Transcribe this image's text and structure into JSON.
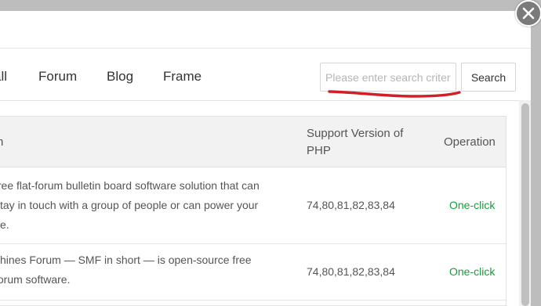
{
  "dialog": {
    "close_icon": "close-icon"
  },
  "tabs": [
    {
      "label": "all"
    },
    {
      "label": "Forum"
    },
    {
      "label": "Blog"
    },
    {
      "label": "Frame"
    }
  ],
  "search": {
    "placeholder": "Please enter search criteria",
    "button_label": "Search"
  },
  "table": {
    "headers": {
      "name": "n",
      "version": "Support Version of PHP",
      "operation": "Operation"
    },
    "rows": [
      {
        "description_lines": [
          "free flat-forum bulletin board software solution that can",
          "stay in touch with a group of people or can power your",
          "ite."
        ],
        "version": "74,80,81,82,83,84",
        "operation": "One-click"
      },
      {
        "description_lines": [
          "chines Forum — SMF in short — is open-source free",
          "forum software."
        ],
        "version": "74,80,81,82,83,84",
        "operation": "One-click"
      }
    ]
  },
  "colors": {
    "operation_link": "#1a9c3a",
    "annotation": "#d11f2a"
  }
}
